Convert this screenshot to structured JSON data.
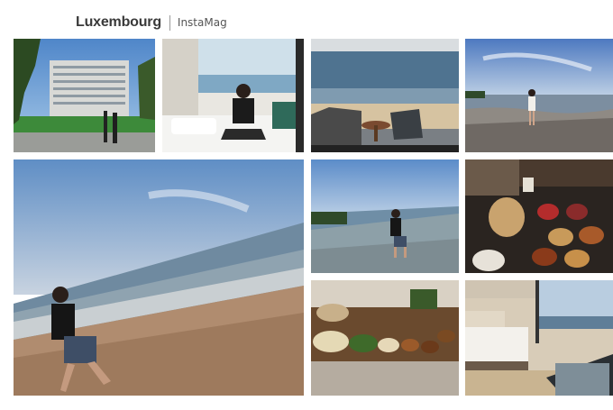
{
  "header": {
    "title": "Luxembourg",
    "brand": "InstaMag"
  },
  "gallery": {
    "photos": [
      {
        "label": "Hotel exterior with palm trees"
      },
      {
        "label": "Person sitting on hotel bed"
      },
      {
        "label": "Balcony ocean view"
      },
      {
        "label": "Person on beach at sunset"
      },
      {
        "label": "Person walking on beach"
      },
      {
        "label": "Person in shallow waves"
      },
      {
        "label": "Buffet dishes"
      },
      {
        "label": "Buffet table spread"
      },
      {
        "label": "Hotel room interior"
      }
    ]
  }
}
